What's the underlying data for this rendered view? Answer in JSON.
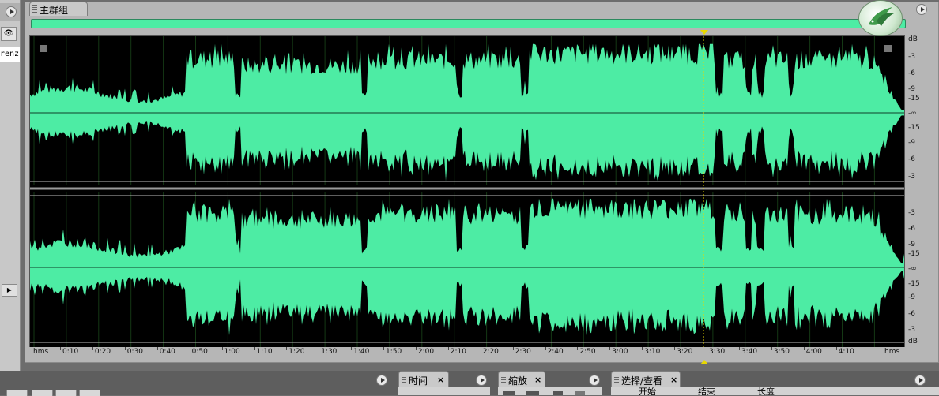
{
  "left_panel": {
    "file_item": "renz"
  },
  "main_tab": {
    "label": "主群组"
  },
  "db_scale": {
    "top_channel": [
      "dB",
      "-3",
      "-6",
      "-9",
      "-15",
      "-∞",
      "-15",
      "-9",
      "-6",
      "-3"
    ],
    "bottom_channel": [
      "-3",
      "-6",
      "-9",
      "-15",
      "-∞",
      "-15",
      "-9",
      "-6",
      "-3",
      "dB"
    ]
  },
  "time_ruler": {
    "start_unit": "hms",
    "end_unit": "hms",
    "labels": [
      "0:10",
      "0:20",
      "0:30",
      "0:40",
      "0:50",
      "1:00",
      "1:10",
      "1:20",
      "1:30",
      "1:40",
      "1:50",
      "2:00",
      "2:10",
      "2:20",
      "2:30",
      "2:40",
      "2:50",
      "3:00",
      "3:10",
      "3:20",
      "3:30",
      "3:40",
      "3:50",
      "4:00",
      "4:10"
    ]
  },
  "playhead_time": "3:27",
  "bottom_tabs": {
    "time": {
      "label": "时间",
      "close": "×"
    },
    "zoom": {
      "label": "缩放",
      "close": "×"
    },
    "selection": {
      "label": "选择/查看",
      "close": "×"
    }
  },
  "selection_columns": [
    "开始",
    "结束",
    "长度"
  ],
  "colors": {
    "waveform": "#4deca4",
    "waveform_background": "#000000",
    "playhead": "#e8d800"
  },
  "icons": {
    "panel_menu": "play-circle-icon",
    "eye": "eye-icon",
    "logo": "bird-logo-icon"
  }
}
